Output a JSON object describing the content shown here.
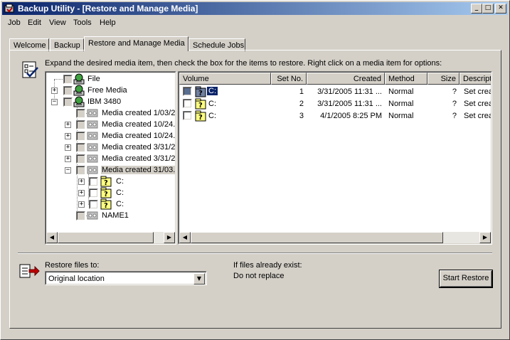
{
  "window": {
    "title": "Backup Utility - [Restore and Manage Media]"
  },
  "menu": [
    "Job",
    "Edit",
    "View",
    "Tools",
    "Help"
  ],
  "tabs": [
    "Welcome",
    "Backup",
    "Restore and Manage Media",
    "Schedule Jobs"
  ],
  "instruction": "Expand the desired media item, then check the box for the items to restore. Right click on a media item for options:",
  "tree": {
    "items": [
      {
        "label": "File"
      },
      {
        "label": "Free Media"
      },
      {
        "label": "IBM 3480"
      },
      {
        "label": "Media created 1/03/2"
      },
      {
        "label": "Media created 10/24."
      },
      {
        "label": "Media created 10/24."
      },
      {
        "label": "Media created 3/31/2"
      },
      {
        "label": "Media created 3/31/2"
      },
      {
        "label": "Media created 31/03."
      },
      {
        "label": "C:"
      },
      {
        "label": "C:"
      },
      {
        "label": "C:"
      },
      {
        "label": "NAME1"
      }
    ]
  },
  "list": {
    "columns": [
      "Volume",
      "Set No.",
      "Created",
      "Method",
      "Size",
      "Descripti"
    ],
    "rows": [
      {
        "volume": "C:",
        "set_no": "1",
        "created": "3/31/2005 11:31 ...",
        "method": "Normal",
        "size": "?",
        "description": "Set crea"
      },
      {
        "volume": "C:",
        "set_no": "2",
        "created": "3/31/2005 11:31 ...",
        "method": "Normal",
        "size": "?",
        "description": "Set crea"
      },
      {
        "volume": "C:",
        "set_no": "3",
        "created": "4/1/2005 8:25 PM",
        "method": "Normal",
        "size": "?",
        "description": "Set crea"
      }
    ]
  },
  "restore": {
    "label": "Restore files to:",
    "location": "Original location",
    "exist_label": "If files already exist:",
    "exist_value": "Do not replace",
    "start_button": "Start Restore"
  },
  "colors": {
    "title_start": "#0a246a",
    "title_end": "#a6caf0",
    "face": "#d4d0c8",
    "selection": "#0a246a"
  }
}
